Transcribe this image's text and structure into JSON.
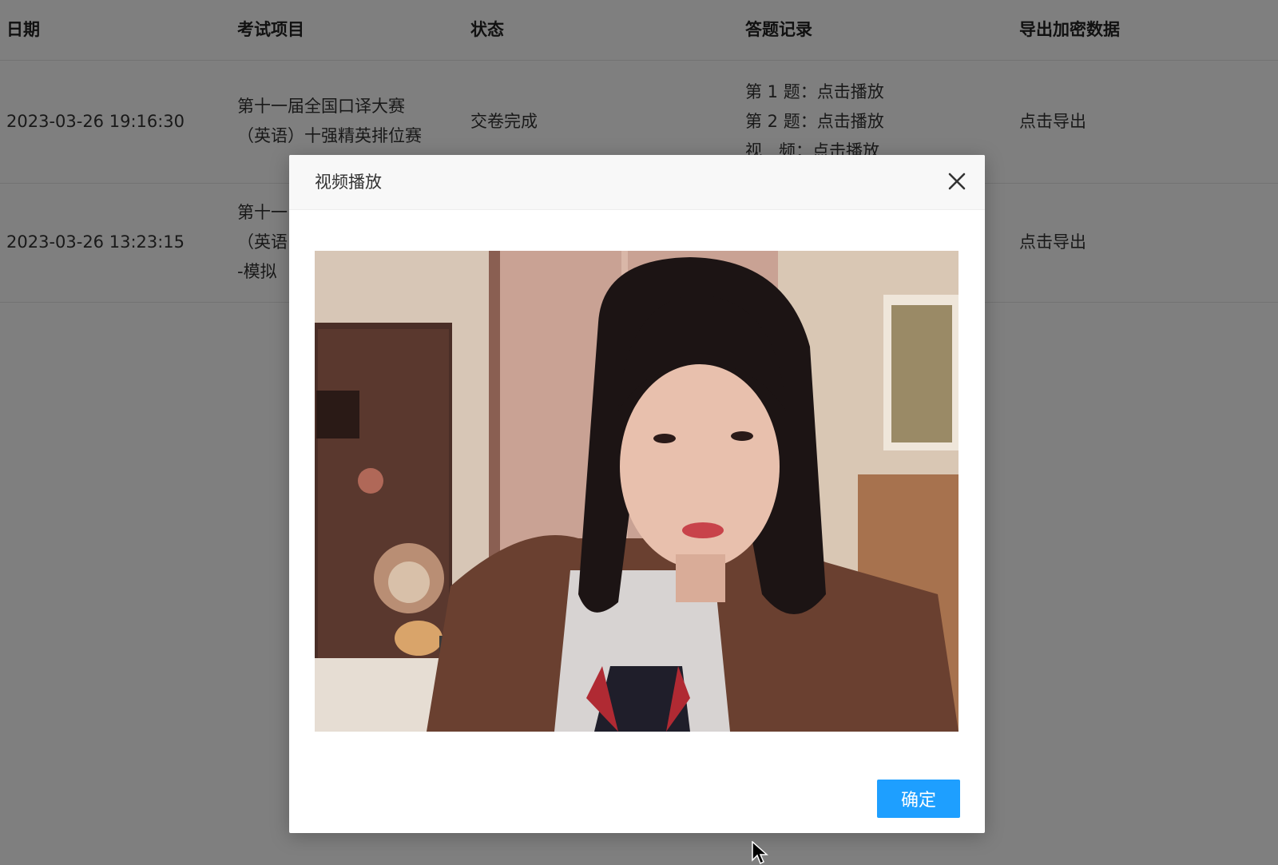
{
  "table": {
    "headers": [
      "日期",
      "考试项目",
      "状态",
      "答题记录",
      "导出加密数据"
    ],
    "rows": [
      {
        "date": "2023-03-26 19:16:30",
        "project_lines": [
          "第十一届全国口译大赛",
          "（英语）十强精英排位赛"
        ],
        "status": "交卷完成",
        "records": [
          "第 1 题：点击播放",
          "第 2 题：点击播放",
          "视　频：点击播放"
        ],
        "export": "点击导出"
      },
      {
        "date": "2023-03-26 13:23:15",
        "project_lines": [
          "第十一",
          "（英语",
          "-模拟"
        ],
        "status": "",
        "records": [],
        "export": "点击导出"
      }
    ]
  },
  "modal": {
    "title": "视频播放",
    "confirm_label": "确定"
  },
  "icons": {
    "close": "close-icon",
    "cursor": "mouse-pointer-icon"
  },
  "colors": {
    "primary_button": "#1e9fff",
    "overlay": "rgba(0,0,0,0.5)"
  }
}
